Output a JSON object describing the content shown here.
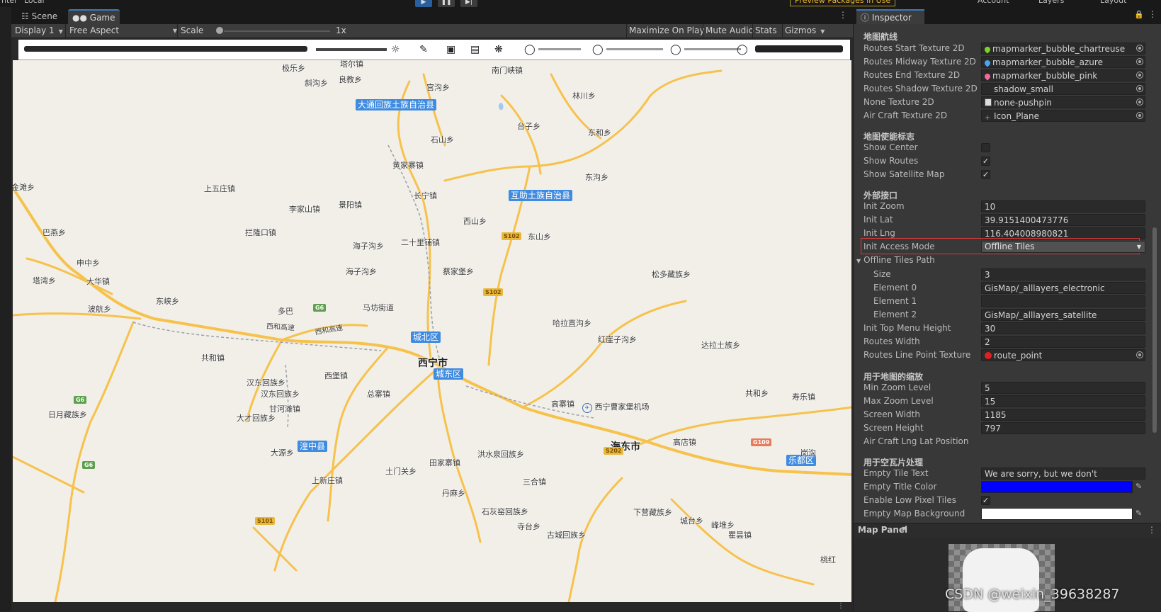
{
  "topbar": {
    "left_label": "nter",
    "local_label": "Local",
    "preview_packages": "Preview Packages in Use",
    "account": "Account",
    "layers": "Layers",
    "layout": "Layout"
  },
  "tabs": {
    "scene": "Scene",
    "game": "Game"
  },
  "game_toolbar": {
    "display": "Display 1",
    "aspect": "Free Aspect",
    "scale_label": "Scale",
    "scale_value": "1x",
    "maximize": "Maximize On Play",
    "mute": "Mute Audio",
    "stats": "Stats",
    "gizmos": "Gizmos"
  },
  "map": {
    "cities": [
      {
        "name": "西宁市"
      },
      {
        "name": "海东市"
      }
    ],
    "counties": [
      {
        "name": "大通回族土族自治县"
      },
      {
        "name": "互助土族自治县"
      },
      {
        "name": "城北区"
      },
      {
        "name": "城东区"
      },
      {
        "name": "湟中县"
      },
      {
        "name": "乐都区"
      }
    ],
    "places": [
      {
        "name": "极乐乡"
      },
      {
        "name": "塔尔镇"
      },
      {
        "name": "斜沟乡"
      },
      {
        "name": "良教乡"
      },
      {
        "name": "南门峡镇"
      },
      {
        "name": "宫沟乡"
      },
      {
        "name": "林川乡"
      },
      {
        "name": "台子乡"
      },
      {
        "name": "石山乡"
      },
      {
        "name": "东和乡"
      },
      {
        "name": "黄家寨镇"
      },
      {
        "name": "东沟乡"
      },
      {
        "name": "金滩乡"
      },
      {
        "name": "上五庄镇"
      },
      {
        "name": "长宁镇"
      },
      {
        "name": "李家山镇"
      },
      {
        "name": "景阳镇"
      },
      {
        "name": "西山乡"
      },
      {
        "name": "巴燕乡"
      },
      {
        "name": "拦隆口镇"
      },
      {
        "name": "东山乡"
      },
      {
        "name": "海子沟乡"
      },
      {
        "name": "二十里铺镇"
      },
      {
        "name": "申中乡"
      },
      {
        "name": "海子沟乡"
      },
      {
        "name": "蔡家堡乡"
      },
      {
        "name": "松多藏族乡"
      },
      {
        "name": "塔湾乡"
      },
      {
        "name": "大华镇"
      },
      {
        "name": "东峡乡"
      },
      {
        "name": "马坊街道"
      },
      {
        "name": "波航乡"
      },
      {
        "name": "多巴"
      },
      {
        "name": "西和高速"
      },
      {
        "name": "西和高速"
      },
      {
        "name": "哈拉直沟乡"
      },
      {
        "name": "红崖子沟乡"
      },
      {
        "name": "达拉土族乡"
      },
      {
        "name": "共和镇"
      },
      {
        "name": "西堡镇"
      },
      {
        "name": "汉东回族乡"
      },
      {
        "name": "汉东回族乡"
      },
      {
        "name": "总寨镇"
      },
      {
        "name": "共和乡"
      },
      {
        "name": "寿乐镇"
      },
      {
        "name": "高寨镇"
      },
      {
        "name": "西宁曹家堡机场"
      },
      {
        "name": "甘河滩镇"
      },
      {
        "name": "日月藏族乡"
      },
      {
        "name": "大才回族乡"
      },
      {
        "name": "高店镇"
      },
      {
        "name": "岗沟"
      },
      {
        "name": "大源乡"
      },
      {
        "name": "洪水泉回族乡"
      },
      {
        "name": "田家寨镇"
      },
      {
        "name": "土门关乡"
      },
      {
        "name": "上新庄镇"
      },
      {
        "name": "三合镇"
      },
      {
        "name": "丹麻乡"
      },
      {
        "name": "下营藏族乡"
      },
      {
        "name": "石灰窑回族乡"
      },
      {
        "name": "城台乡"
      },
      {
        "name": "峰堆乡"
      },
      {
        "name": "寺台乡"
      },
      {
        "name": "古城回族乡"
      },
      {
        "name": "瞿昙镇"
      },
      {
        "name": "桃红"
      }
    ],
    "shields": [
      {
        "text": "G6",
        "kind": "g"
      },
      {
        "text": "G6",
        "kind": "g"
      },
      {
        "text": "G6",
        "kind": "g"
      },
      {
        "text": "S102",
        "kind": "s"
      },
      {
        "text": "S102",
        "kind": "s"
      },
      {
        "text": "S202",
        "kind": "s"
      },
      {
        "text": "S101",
        "kind": "s"
      },
      {
        "text": "G109",
        "kind": "r"
      }
    ]
  },
  "inspector": {
    "tab": "Inspector",
    "sections": {
      "routes": "地图航线",
      "display": "地图使能标志",
      "external": "外部接口",
      "zoom": "用于地图的缩放",
      "empty": "用于空瓦片处理"
    },
    "fields": {
      "routes_start_label": "Routes Start Texture 2D",
      "routes_start_value": "mapmarker_bubble_chartreuse",
      "routes_mid_label": "Routes Midway Texture 2D",
      "routes_mid_value": "mapmarker_bubble_azure",
      "routes_end_label": "Routes End Texture 2D",
      "routes_end_value": "mapmarker_bubble_pink",
      "routes_shadow_label": "Routes Shadow Texture 2D",
      "routes_shadow_value": "shadow_small",
      "none_tex_label": "None Texture 2D",
      "none_tex_value": "none-pushpin",
      "aircraft_tex_label": "Air Craft Texture 2D",
      "aircraft_tex_value": "Icon_Plane",
      "show_center_label": "Show Center",
      "show_routes_label": "Show Routes",
      "show_sat_label": "Show Satellite Map",
      "init_zoom_label": "Init Zoom",
      "init_zoom_value": "10",
      "init_lat_label": "Init Lat",
      "init_lat_value": "39.9151400473776",
      "init_lng_label": "Init Lng",
      "init_lng_value": "116.404008980821",
      "access_mode_label": "Init Access Mode",
      "access_mode_value": "Offline Tiles",
      "offline_path_label": "Offline Tiles Path",
      "size_label": "Size",
      "size_value": "3",
      "el0_label": "Element 0",
      "el0_value": "GisMap/_alllayers_electronic",
      "el1_label": "Element 1",
      "el1_value": "",
      "el2_label": "Element 2",
      "el2_value": "GisMap/_alllayers_satellite",
      "top_menu_label": "Init Top Menu Height",
      "top_menu_value": "30",
      "routes_width_label": "Routes Width",
      "routes_width_value": "2",
      "route_point_label": "Routes Line Point Texture",
      "route_point_value": "route_point",
      "min_zoom_label": "Min Zoom Level",
      "min_zoom_value": "5",
      "max_zoom_label": "Max Zoom Level",
      "max_zoom_value": "15",
      "screen_w_label": "Screen Width",
      "screen_w_value": "1185",
      "screen_h_label": "Screen Height",
      "screen_h_value": "797",
      "aircraft_pos_label": "Air Craft Lng Lat Position",
      "empty_text_label": "Empty Tile Text",
      "empty_text_value": "We are sorry, but we don't",
      "empty_color_label": "Empty Title Color",
      "low_pixel_label": "Enable Low Pixel Tiles",
      "empty_bg_label": "Empty Map Background"
    },
    "checkboxes": {
      "show_center": false,
      "show_routes": true,
      "show_sat": true,
      "low_pixel": true
    },
    "colors": {
      "empty_title": "#0000ff",
      "empty_bg": "#ffffff",
      "start": "#7ed321",
      "mid": "#4aa3f0",
      "end": "#f06a9a",
      "route_point": "#e02020"
    },
    "map_panel": "Map Panel"
  },
  "watermark": "CSDN @weixin_39638287"
}
